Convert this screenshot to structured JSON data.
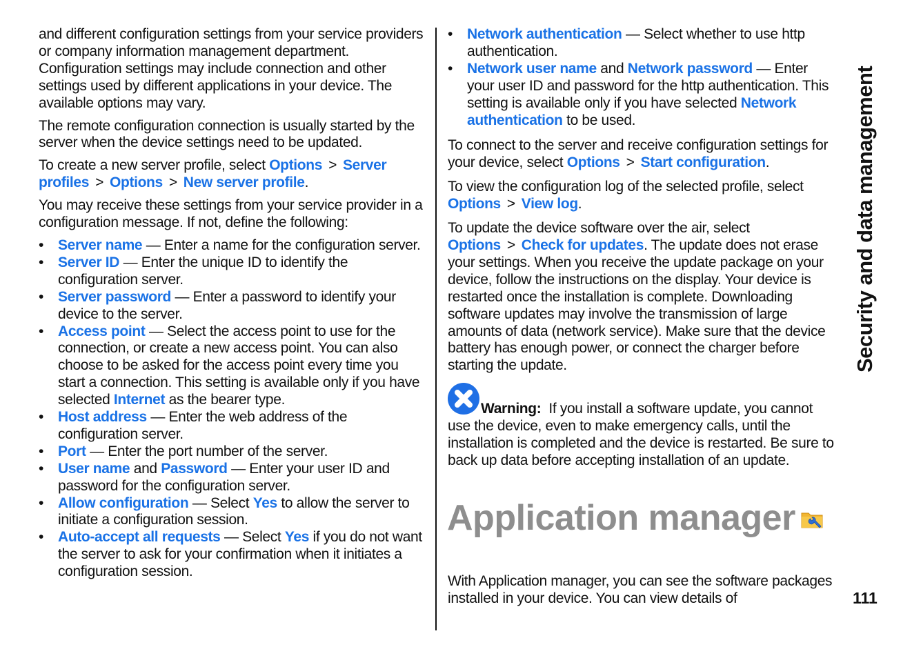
{
  "side_tab": "Security and data management",
  "page_number": "111",
  "colors": {
    "link": "#1a72e6",
    "heading": "#8e8e8e",
    "warning_icon": "#1f6fe5"
  },
  "left": {
    "p1": "and different configuration settings from your service providers or company information management department. Configuration settings may include connection and other settings used by different applications in your device. The available options may vary.",
    "p2": "The remote configuration connection is usually started by the server when the device settings need to be updated.",
    "p3": {
      "pre": "To create a new server profile, select ",
      "path": [
        "Options",
        "Server profiles",
        "Options",
        "New server profile"
      ],
      "sep": ">",
      "post": "."
    },
    "p4": "You may receive these settings from your service provider in a configuration message. If not, define the following:",
    "bullets": [
      {
        "term": "Server name",
        "desc": " — Enter a name for the configuration server."
      },
      {
        "term": "Server ID",
        "desc": " — Enter the unique ID to identify the configuration server."
      },
      {
        "term": "Server password",
        "desc": " — Enter a password to identify your device to the server."
      },
      {
        "term": "Access point",
        "desc": " — Select the access point to use for the connection, or create a new access point. You can also choose to be asked for the access point every time you start a connection. This setting is available only if you have selected ",
        "term2": "Internet",
        "desc2": " as the bearer type."
      },
      {
        "term": "Host address",
        "desc": " — Enter the web address of the configuration server."
      },
      {
        "term": "Port",
        "desc": " — Enter the port number of the server."
      },
      {
        "term": "User name",
        "and": " and ",
        "term2": "Password",
        "desc": " — Enter your user ID and password for the configuration server."
      },
      {
        "term": "Allow configuration",
        "desc": " — Select ",
        "term2": "Yes",
        "desc2": " to allow the server to initiate a configuration session."
      },
      {
        "term": "Auto-accept all requests",
        "desc": " — Select ",
        "term2": "Yes",
        "desc2": " if you do not want the server to ask for your confirmation when it initiates a configuration session."
      }
    ]
  },
  "right": {
    "bullets": [
      {
        "term": "Network authentication",
        "desc": " — Select whether to use http authentication."
      },
      {
        "term": "Network user name",
        "and": " and ",
        "term2": "Network password",
        "desc": " — Enter your user ID and password for the http authentication. This setting is available only if you have selected ",
        "term3": "Network authentication",
        "desc2": " to be used."
      }
    ],
    "p_connect": {
      "pre": "To connect to the server and receive configuration settings for your device, select ",
      "path": [
        "Options",
        "Start configuration"
      ],
      "post": "."
    },
    "p_log": {
      "pre": "To view the configuration log of the selected profile, select ",
      "path": [
        "Options",
        "View log"
      ],
      "post": "."
    },
    "p_update": {
      "pre": "To update the device software over the air, select ",
      "path": [
        "Options",
        "Check for updates"
      ],
      "post": ". The update does not erase your settings. When you receive the update package on your device, follow the instructions on the display. Your device is restarted once the installation is complete. Downloading software updates may involve the transmission of large amounts of data (network service). Make sure that the device battery has enough power, or connect the charger before starting the update."
    },
    "warning": {
      "icon": "warning-x-icon",
      "label": "Warning:",
      "text": "  If you install a software update, you cannot use the device, even to make emergency calls, until the installation is completed and the device is restarted. Be sure to back up data before accepting installation of an update."
    },
    "section": {
      "title": "Application manager",
      "icon": "folder-wrench-icon"
    },
    "p_intro": "With Application manager, you can see the software packages installed in your device. You can view details of"
  },
  "sep": ">"
}
